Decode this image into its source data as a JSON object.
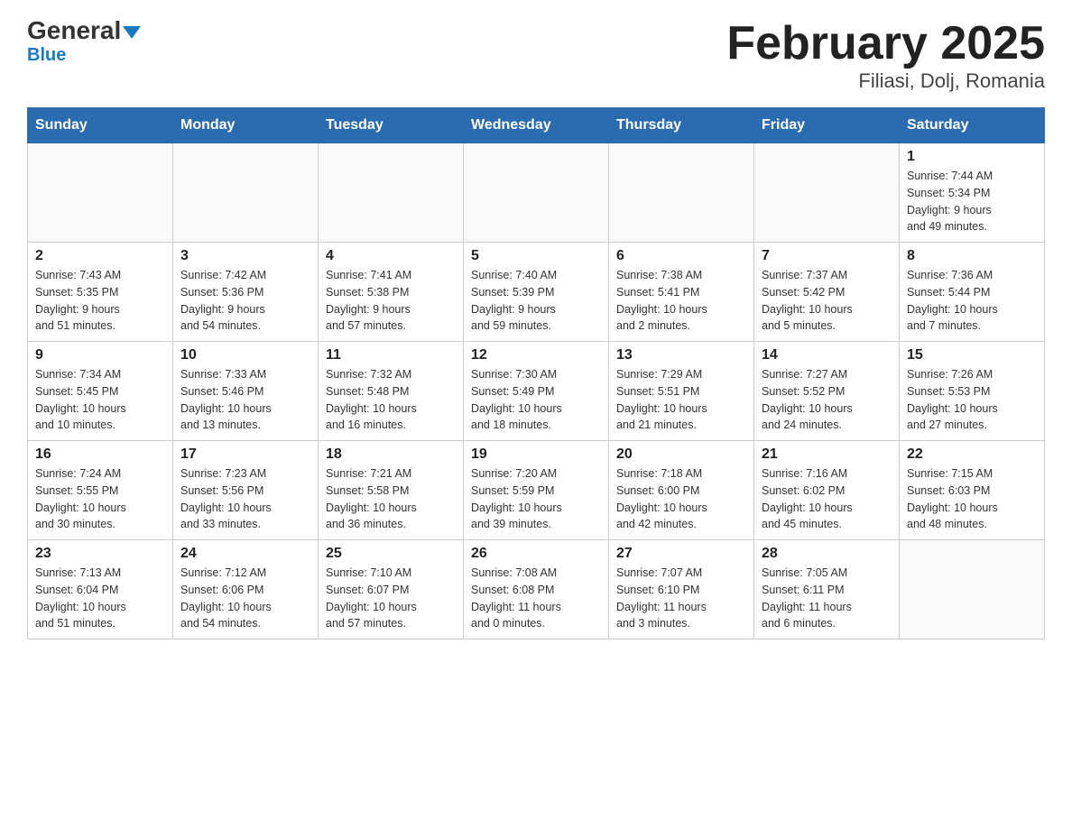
{
  "header": {
    "logo_general": "General",
    "logo_blue": "Blue",
    "title": "February 2025",
    "subtitle": "Filiasi, Dolj, Romania"
  },
  "days_of_week": [
    "Sunday",
    "Monday",
    "Tuesday",
    "Wednesday",
    "Thursday",
    "Friday",
    "Saturday"
  ],
  "weeks": [
    [
      {
        "day": "",
        "info": ""
      },
      {
        "day": "",
        "info": ""
      },
      {
        "day": "",
        "info": ""
      },
      {
        "day": "",
        "info": ""
      },
      {
        "day": "",
        "info": ""
      },
      {
        "day": "",
        "info": ""
      },
      {
        "day": "1",
        "info": "Sunrise: 7:44 AM\nSunset: 5:34 PM\nDaylight: 9 hours\nand 49 minutes."
      }
    ],
    [
      {
        "day": "2",
        "info": "Sunrise: 7:43 AM\nSunset: 5:35 PM\nDaylight: 9 hours\nand 51 minutes."
      },
      {
        "day": "3",
        "info": "Sunrise: 7:42 AM\nSunset: 5:36 PM\nDaylight: 9 hours\nand 54 minutes."
      },
      {
        "day": "4",
        "info": "Sunrise: 7:41 AM\nSunset: 5:38 PM\nDaylight: 9 hours\nand 57 minutes."
      },
      {
        "day": "5",
        "info": "Sunrise: 7:40 AM\nSunset: 5:39 PM\nDaylight: 9 hours\nand 59 minutes."
      },
      {
        "day": "6",
        "info": "Sunrise: 7:38 AM\nSunset: 5:41 PM\nDaylight: 10 hours\nand 2 minutes."
      },
      {
        "day": "7",
        "info": "Sunrise: 7:37 AM\nSunset: 5:42 PM\nDaylight: 10 hours\nand 5 minutes."
      },
      {
        "day": "8",
        "info": "Sunrise: 7:36 AM\nSunset: 5:44 PM\nDaylight: 10 hours\nand 7 minutes."
      }
    ],
    [
      {
        "day": "9",
        "info": "Sunrise: 7:34 AM\nSunset: 5:45 PM\nDaylight: 10 hours\nand 10 minutes."
      },
      {
        "day": "10",
        "info": "Sunrise: 7:33 AM\nSunset: 5:46 PM\nDaylight: 10 hours\nand 13 minutes."
      },
      {
        "day": "11",
        "info": "Sunrise: 7:32 AM\nSunset: 5:48 PM\nDaylight: 10 hours\nand 16 minutes."
      },
      {
        "day": "12",
        "info": "Sunrise: 7:30 AM\nSunset: 5:49 PM\nDaylight: 10 hours\nand 18 minutes."
      },
      {
        "day": "13",
        "info": "Sunrise: 7:29 AM\nSunset: 5:51 PM\nDaylight: 10 hours\nand 21 minutes."
      },
      {
        "day": "14",
        "info": "Sunrise: 7:27 AM\nSunset: 5:52 PM\nDaylight: 10 hours\nand 24 minutes."
      },
      {
        "day": "15",
        "info": "Sunrise: 7:26 AM\nSunset: 5:53 PM\nDaylight: 10 hours\nand 27 minutes."
      }
    ],
    [
      {
        "day": "16",
        "info": "Sunrise: 7:24 AM\nSunset: 5:55 PM\nDaylight: 10 hours\nand 30 minutes."
      },
      {
        "day": "17",
        "info": "Sunrise: 7:23 AM\nSunset: 5:56 PM\nDaylight: 10 hours\nand 33 minutes."
      },
      {
        "day": "18",
        "info": "Sunrise: 7:21 AM\nSunset: 5:58 PM\nDaylight: 10 hours\nand 36 minutes."
      },
      {
        "day": "19",
        "info": "Sunrise: 7:20 AM\nSunset: 5:59 PM\nDaylight: 10 hours\nand 39 minutes."
      },
      {
        "day": "20",
        "info": "Sunrise: 7:18 AM\nSunset: 6:00 PM\nDaylight: 10 hours\nand 42 minutes."
      },
      {
        "day": "21",
        "info": "Sunrise: 7:16 AM\nSunset: 6:02 PM\nDaylight: 10 hours\nand 45 minutes."
      },
      {
        "day": "22",
        "info": "Sunrise: 7:15 AM\nSunset: 6:03 PM\nDaylight: 10 hours\nand 48 minutes."
      }
    ],
    [
      {
        "day": "23",
        "info": "Sunrise: 7:13 AM\nSunset: 6:04 PM\nDaylight: 10 hours\nand 51 minutes."
      },
      {
        "day": "24",
        "info": "Sunrise: 7:12 AM\nSunset: 6:06 PM\nDaylight: 10 hours\nand 54 minutes."
      },
      {
        "day": "25",
        "info": "Sunrise: 7:10 AM\nSunset: 6:07 PM\nDaylight: 10 hours\nand 57 minutes."
      },
      {
        "day": "26",
        "info": "Sunrise: 7:08 AM\nSunset: 6:08 PM\nDaylight: 11 hours\nand 0 minutes."
      },
      {
        "day": "27",
        "info": "Sunrise: 7:07 AM\nSunset: 6:10 PM\nDaylight: 11 hours\nand 3 minutes."
      },
      {
        "day": "28",
        "info": "Sunrise: 7:05 AM\nSunset: 6:11 PM\nDaylight: 11 hours\nand 6 minutes."
      },
      {
        "day": "",
        "info": ""
      }
    ]
  ]
}
